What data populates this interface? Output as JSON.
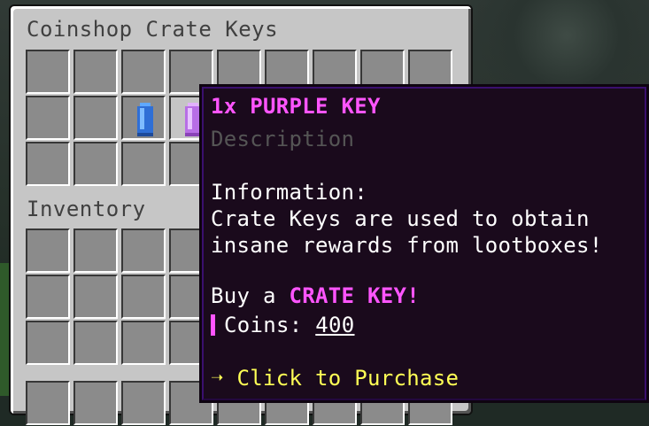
{
  "gui": {
    "title": "Coinshop Crate Keys",
    "inventory_title": "Inventory"
  },
  "items": {
    "blue_key": {
      "icon": "blue-key-icon",
      "color": "#3a7fe0"
    },
    "purple_key": {
      "icon": "purple-key-icon",
      "color": "#c07ce8"
    }
  },
  "tooltip": {
    "title": "1x PURPLE KEY",
    "description": "Description",
    "info_heading": "Information:",
    "info_line1": "Crate Keys are used to obtain",
    "info_line2": "insane rewards from lootboxes!",
    "buy_prefix": "Buy a ",
    "buy_item": "CRATE KEY!",
    "coins_label": "Coins: ",
    "coins_amount": "400",
    "click": "➝ Click to Purchase"
  },
  "colors": {
    "tooltip_title": "#ff55ff",
    "tooltip_click": "#ffff55",
    "tooltip_desc": "#555555"
  }
}
